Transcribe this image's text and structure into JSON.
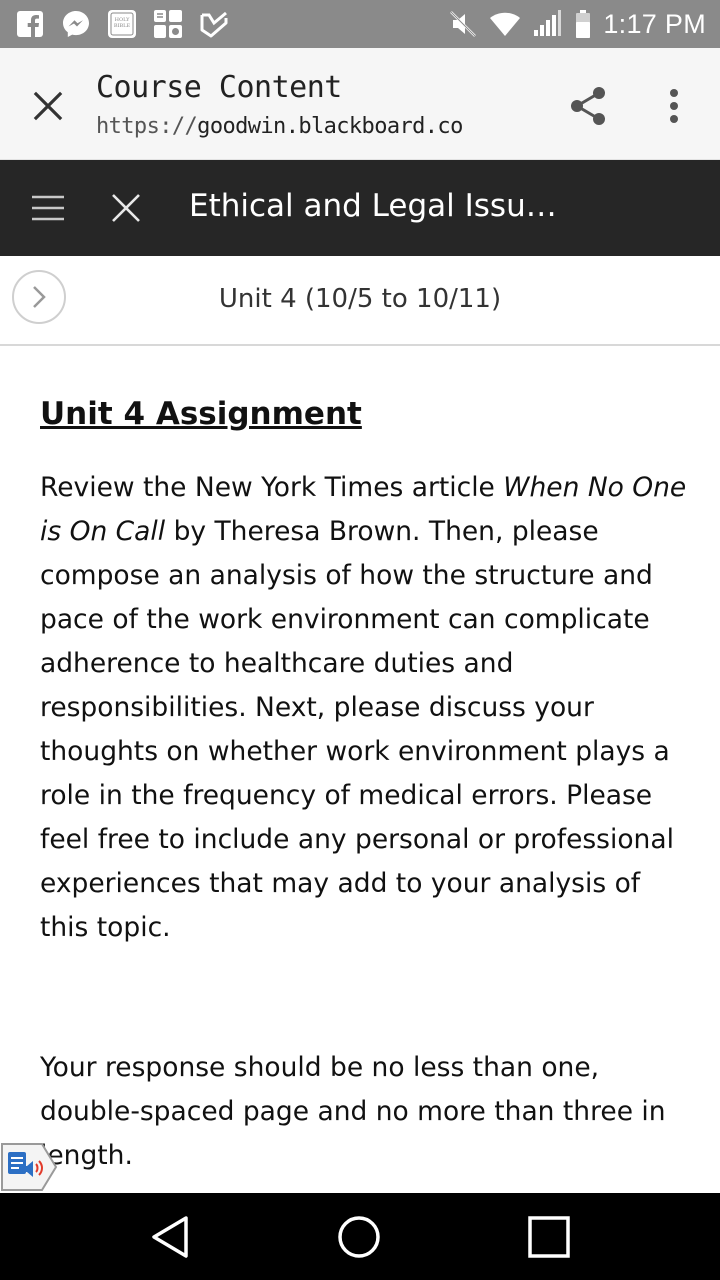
{
  "status_bar": {
    "time": "1:17 PM",
    "left_icons": [
      "facebook-icon",
      "messenger-icon",
      "holy-bible-icon",
      "app-grid-icon",
      "check-inbox-icon"
    ],
    "right_icons": [
      "mute-icon",
      "wifi-icon",
      "signal-icon",
      "battery-icon"
    ],
    "bible_label": "HOLY BIBLE"
  },
  "tab_header": {
    "title": "Course Content",
    "url_scheme": "https://",
    "url_host": "goodwin.blackboard.com"
  },
  "app_bar": {
    "title": "Ethical and Legal Issu…"
  },
  "unit": {
    "title": "Unit 4 (10/5 to 10/11)"
  },
  "content": {
    "heading": "Unit 4 Assignment",
    "p1_before": "Review the New York Times article ",
    "p1_italic": "When No One is On Call",
    "p1_after": " by Theresa Brown. Then, please compose an analysis of how the structure and pace of the work environment can complicate adherence to healthcare duties and responsibilities. Next, please discuss your thoughts on whether work environment plays a role in the frequency of medical errors. Please feel free to include any personal or professional experiences that may add to your analysis of this topic.",
    "p2": "Your response should be no less than one, double-spaced page and no more than three in length."
  },
  "colors": {
    "status_bar": "#8a8a8a",
    "app_bar": "#262626",
    "tab_header": "#f6f6f6",
    "nav_bar": "#000000"
  },
  "nav_bar": {
    "buttons": [
      "back-icon",
      "home-icon",
      "recents-icon"
    ]
  }
}
